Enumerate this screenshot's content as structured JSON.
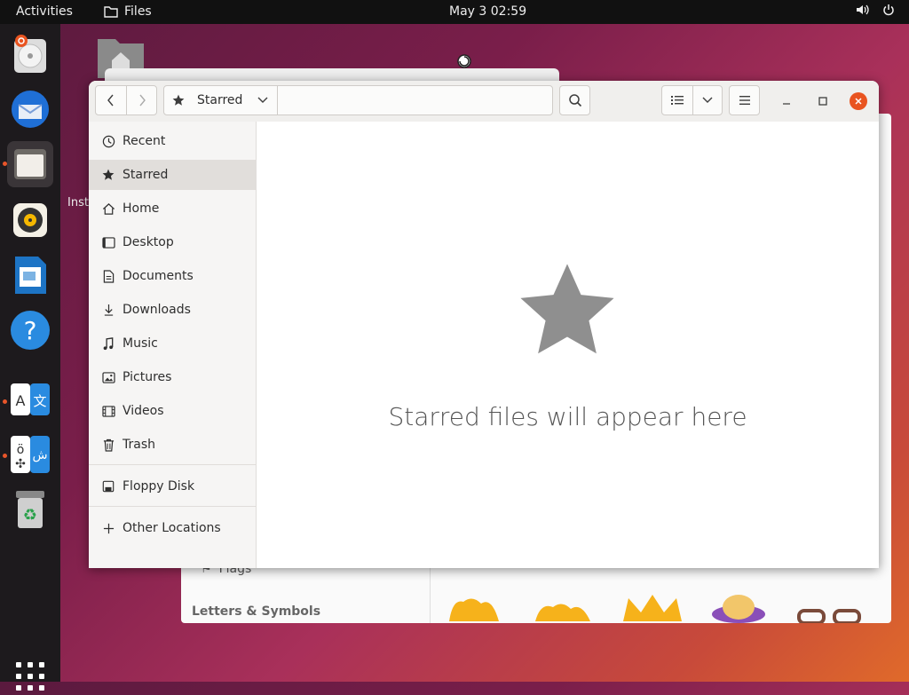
{
  "topbar": {
    "activities": "Activities",
    "app_name": "Files",
    "clock": "May 3  02:59"
  },
  "desktop": {
    "truncated_label": "Inst"
  },
  "bg_window": {
    "flags_label": "Flags",
    "section_label": "Letters & Symbols"
  },
  "window": {
    "path_current": "Starred",
    "placeholder": "Starred files will appear here"
  },
  "sidebar": {
    "items": [
      {
        "label": "Recent",
        "icon": "clock-icon"
      },
      {
        "label": "Starred",
        "icon": "star-icon"
      },
      {
        "label": "Home",
        "icon": "home-icon"
      },
      {
        "label": "Desktop",
        "icon": "desktop-icon"
      },
      {
        "label": "Documents",
        "icon": "document-icon"
      },
      {
        "label": "Downloads",
        "icon": "download-icon"
      },
      {
        "label": "Music",
        "icon": "music-icon"
      },
      {
        "label": "Pictures",
        "icon": "pictures-icon"
      },
      {
        "label": "Videos",
        "icon": "video-icon"
      },
      {
        "label": "Trash",
        "icon": "trash-icon"
      },
      {
        "label": "Floppy Disk",
        "icon": "floppy-icon"
      },
      {
        "label": "Other Locations",
        "icon": "plus-icon"
      }
    ],
    "selected": "Starred"
  },
  "colors": {
    "accent": "#e95420",
    "star": "#8f8f8f"
  }
}
